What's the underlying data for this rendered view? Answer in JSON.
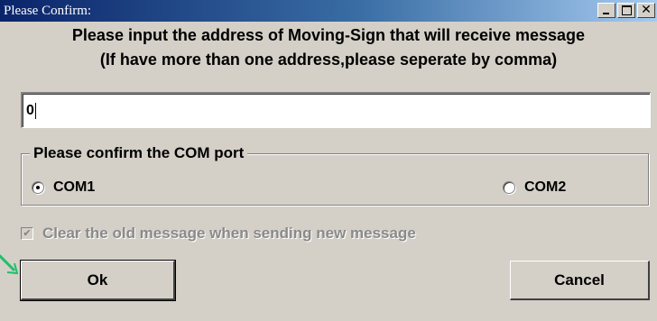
{
  "window": {
    "title": "Please Confirm:",
    "controls": [
      "minimize-icon",
      "maximize-icon",
      "close-icon"
    ]
  },
  "prompt": {
    "line1": "Please input the address of Moving-Sign that will receive message",
    "line2": "(If have more than one address,please seperate by comma)"
  },
  "address_input": {
    "value": "0"
  },
  "com_group": {
    "legend": "Please confirm the COM port",
    "options": [
      {
        "label": "COM1",
        "checked": true
      },
      {
        "label": "COM2",
        "checked": false
      }
    ]
  },
  "clear_option": {
    "label": "Clear the old message when sending new message",
    "checked": true,
    "enabled": false
  },
  "buttons": {
    "ok_label": "Ok",
    "cancel_label": "Cancel"
  },
  "colors": {
    "window_bg": "#d4d0c8",
    "title_start": "#0a246a",
    "title_end": "#a6caf0",
    "annotation_arrow": "#1fbf6a"
  }
}
